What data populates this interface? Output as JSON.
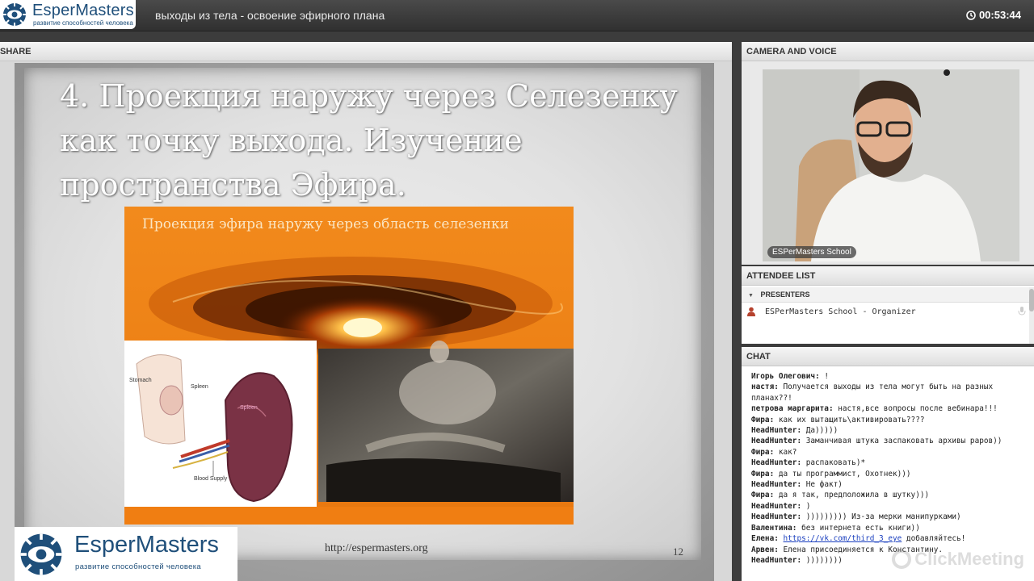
{
  "app": {
    "brand_name": "EsperMasters",
    "brand_tagline": "развитие способностей человека",
    "window_title": "выходы из тела - освоение эфирного плана",
    "timer": "00:53:44"
  },
  "share": {
    "header": "SHARE",
    "slide": {
      "title": "4. Проекция наружу через Селезенку как точку выхода. Изучение пространства Эфира.",
      "picture_title": "Проекция эфира наружу через область селезенки",
      "anatomy_labels": {
        "stomach": "Stomach",
        "spleen_small": "Spleen",
        "spleen_big": "Spleen",
        "blood_supply": "Blood Supply"
      },
      "url": "http://espermasters.org",
      "page_number": "12",
      "logo_name": "EsperMasters",
      "logo_tagline": "развитие способностей человека"
    }
  },
  "camera": {
    "header": "CAMERA AND VOICE",
    "video_label": "ESPerMasters School"
  },
  "attendees": {
    "header": "ATTENDEE LIST",
    "group": "PRESENTERS",
    "rows": [
      {
        "name": "ESPerMasters School - Organizer"
      }
    ]
  },
  "chat": {
    "header": "CHAT",
    "messages": [
      {
        "author": "Игорь Олегович:",
        "text": " !"
      },
      {
        "author": "настя:",
        "text": " Получается выходы из тела могут быть на разных планах??!"
      },
      {
        "author": "петрова маргарита:",
        "text": " настя,все вопросы после вебинара!!!"
      },
      {
        "author": "Фира:",
        "text": " как их вытащить\\активировать????"
      },
      {
        "author": "HeadHunter:",
        "text": " Да)))))"
      },
      {
        "author": "HeadHunter:",
        "text": " Заманчивая штука заспаковать архивы раров))"
      },
      {
        "author": "Фира:",
        "text": " как?"
      },
      {
        "author": "HeadHunter:",
        "text": " распаковать)*"
      },
      {
        "author": "Фира:",
        "text": " да ты программист, Охотнек)))"
      },
      {
        "author": "HeadHunter:",
        "text": " Не факт)"
      },
      {
        "author": "Фира:",
        "text": " да я так, предположила в шутку)))"
      },
      {
        "author": "HeadHunter:",
        "text": " )"
      },
      {
        "author": "HeadHunter:",
        "text": " ))))))))) Из-за мерки манипурками)"
      },
      {
        "author": "Валентина:",
        "text": " без интернета есть книги))"
      },
      {
        "author": "Елена:",
        "text": " добавляйтесь!",
        "link": "https://vk.com/third_3_eye"
      },
      {
        "author": "Арвен:",
        "text": " Елена присоединяется к Константину."
      },
      {
        "author": "HeadHunter:",
        "text": " ))))))))"
      }
    ],
    "watermark": "ClickMeeting"
  }
}
